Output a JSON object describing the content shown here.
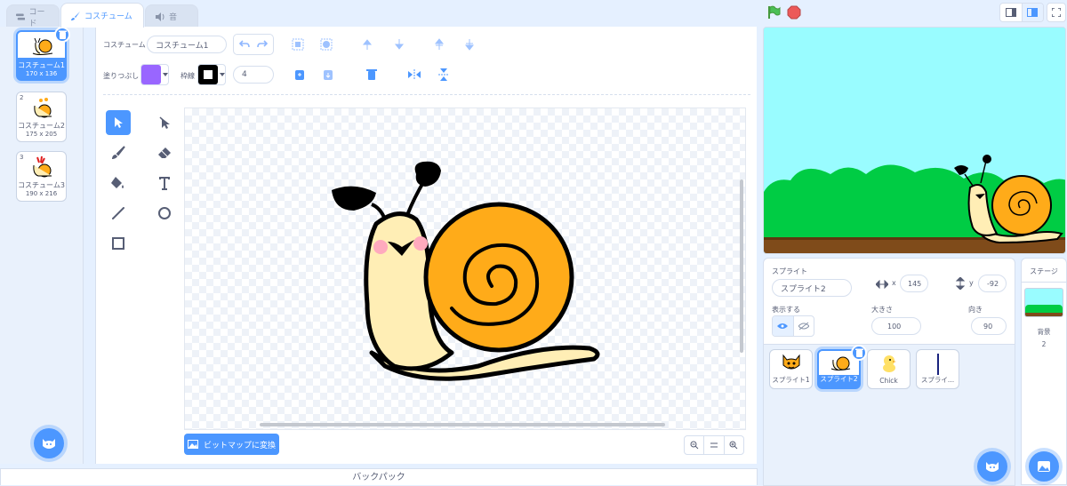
{
  "tabs": {
    "code": "コード",
    "costume": "コスチューム",
    "sound": "音"
  },
  "costumes": [
    {
      "num": "1",
      "name": "コスチューム1",
      "size": "170 x 136",
      "selected": true
    },
    {
      "num": "2",
      "name": "コスチューム2",
      "size": "175 x 205",
      "selected": false
    },
    {
      "num": "3",
      "name": "コスチューム3",
      "size": "190 x 216",
      "selected": false
    }
  ],
  "editor": {
    "costume_label": "コスチューム",
    "costume_name": "コスチューム1",
    "fill_label": "塗りつぶし",
    "outline_label": "枠線",
    "outline_size": "4",
    "fill_color": "#9966ff",
    "outline_color": "#000000",
    "convert_button": "ビットマップに変換"
  },
  "sprite_info": {
    "sprite_label": "スプライト",
    "sprite_name": "スプライト2",
    "x_label": "x",
    "x_value": "145",
    "y_label": "y",
    "y_value": "-92",
    "show_label": "表示する",
    "size_label": "大きさ",
    "size_value": "100",
    "direction_label": "向き",
    "direction_value": "90"
  },
  "sprites": [
    {
      "name": "スプライト1"
    },
    {
      "name": "スプライト2"
    },
    {
      "name": "Chick"
    },
    {
      "name": "スプライ..."
    }
  ],
  "stage_panel": {
    "title": "ステージ",
    "backdrop_label": "背景",
    "backdrop_count": "2"
  },
  "backpack": "バックパック",
  "colors": {
    "accent": "#4c97ff",
    "snail_shell": "#ffab19",
    "snail_body": "#ffeeb5",
    "stage_sky": "#99fcff",
    "bush": "#00cc44",
    "ground": "#7f4b1a"
  }
}
